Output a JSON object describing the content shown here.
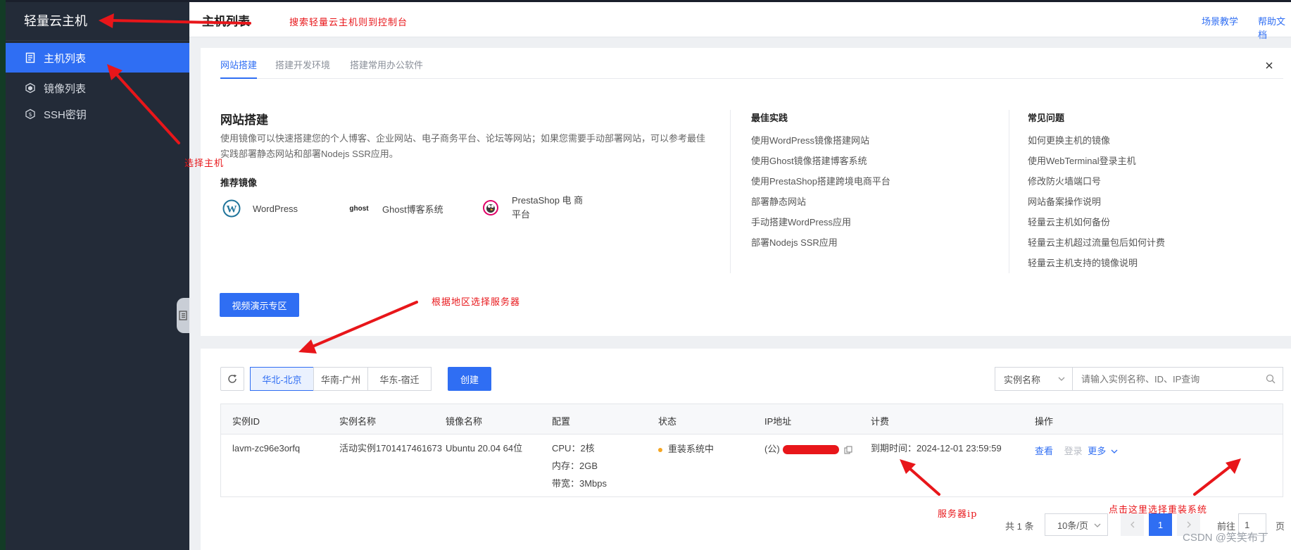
{
  "sidebar": {
    "brand": "轻量云主机",
    "items": [
      {
        "label": "主机列表",
        "icon": "document-icon",
        "active": true
      },
      {
        "label": "镜像列表",
        "icon": "cube-icon",
        "active": false
      },
      {
        "label": "SSH密钥",
        "icon": "shield-icon",
        "active": false
      }
    ]
  },
  "header": {
    "title": "主机列表",
    "links": [
      "场景教学",
      "帮助文档"
    ]
  },
  "guide": {
    "tabs": [
      "网站搭建",
      "搭建开发环境",
      "搭建常用办公软件"
    ],
    "title": "网站搭建",
    "description": "使用镜像可以快速搭建您的个人博客、企业网站、电子商务平台、论坛等网站；如果您需要手动部署网站，可以参考最佳实践部署静态网站和部署Nodejs SSR应用。",
    "recommend_title": "推荐镜像",
    "images": [
      {
        "name": "WordPress",
        "icon": "wordpress-logo-icon"
      },
      {
        "name": "Ghost博客系统",
        "icon": "ghost-logo-icon",
        "logo_text": "ghost"
      },
      {
        "name_line1": "PrestaShop 电 商",
        "name_line2": "平台",
        "icon": "prestashop-logo-icon"
      }
    ],
    "best_practice": {
      "title": "最佳实践",
      "links": [
        "使用WordPress镜像搭建网站",
        "使用Ghost镜像搭建博客系统",
        "使用PrestaShop搭建跨境电商平台",
        "部署静态网站",
        "手动搭建WordPress应用",
        "部署Nodejs SSR应用"
      ]
    },
    "faq": {
      "title": "常见问题",
      "links": [
        "如何更换主机的镜像",
        "使用WebTerminal登录主机",
        "修改防火墙端口号",
        "网站备案操作说明",
        "轻量云主机如何备份",
        "轻量云主机超过流量包后如何计费",
        "轻量云主机支持的镜像说明"
      ]
    },
    "video_button": "视频演示专区"
  },
  "toolbar": {
    "regions": [
      "华北-北京",
      "华南-广州",
      "华东-宿迁"
    ],
    "active_region": "华北-北京",
    "create_label": "创建",
    "search_type": "实例名称",
    "search_placeholder": "请输入实例名称、ID、IP查询"
  },
  "table": {
    "columns": [
      "实例ID",
      "实例名称",
      "镜像名称",
      "配置",
      "状态",
      "IP地址",
      "计费",
      "操作"
    ],
    "rows": [
      {
        "id": "lavm-zc96e3orfq",
        "name": "活动实例1701417461673",
        "image": "Ubuntu 20.04 64位",
        "cpu": "CPU：2核",
        "memory": "内存：2GB",
        "bandwidth": "带宽：3Mbps",
        "status": "重装系统中",
        "ip_prefix": "(公)",
        "billing": "到期时间：2024-12-01 23:59:59",
        "actions": {
          "view": "查看",
          "login": "登录",
          "more": "更多"
        }
      }
    ]
  },
  "pagination": {
    "total": "共 1 条",
    "page_size": "10条/页",
    "current_page": "1",
    "goto_label": "前往",
    "goto_value": "1",
    "page_suffix": "页"
  },
  "annotations": {
    "search_console": "搜索轻量云主机则到控制台",
    "select_host": "选择主机",
    "select_region": "根据地区选择服务器",
    "server_ip": "服务器ip",
    "reinstall": "点击这里选择重装系统",
    "color": "#e8161a"
  },
  "watermark": "CSDN @笑笑布丁",
  "colors": {
    "accent": "#2f6ef3",
    "sidebar": "#232b38",
    "status_pending": "#f5a623"
  }
}
